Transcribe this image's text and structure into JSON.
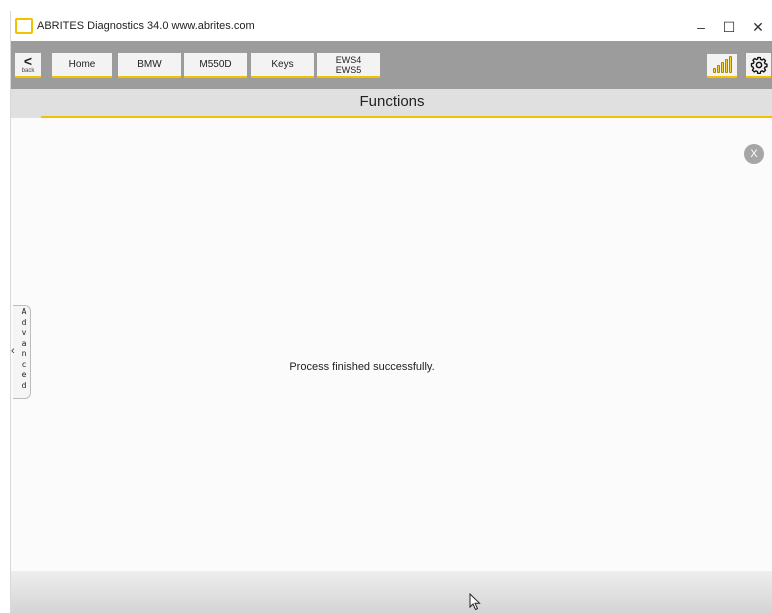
{
  "window": {
    "title": "ABRITES Diagnostics 34.0   www.abrites.com",
    "minimize_glyph": "–",
    "maximize_glyph": "☐",
    "close_glyph": "✕"
  },
  "toolbar": {
    "back_glyph": "<",
    "back_label": "back",
    "breadcrumbs": [
      "Home",
      "BMW",
      "M550D",
      "Keys"
    ],
    "last_crumb": [
      "EWS4",
      "EWS5"
    ],
    "icons": [
      "signal-strength-icon",
      "gear-icon"
    ]
  },
  "header": {
    "title": "Functions"
  },
  "main": {
    "close_label": "X",
    "message": "Process finished successfully."
  },
  "advanced": {
    "chevron": "‹",
    "letters": [
      "A",
      "d",
      "v",
      "a",
      "n",
      "c",
      "e",
      "d"
    ]
  },
  "colors": {
    "accent": "#f2c200",
    "toolbar": "#9c9c9c",
    "header_bg": "#e0e0e0"
  }
}
